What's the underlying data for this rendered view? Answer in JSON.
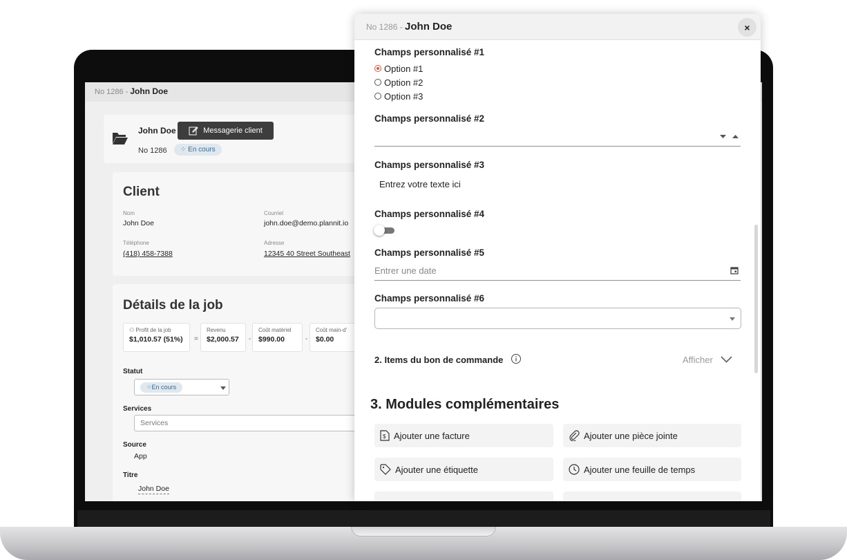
{
  "background_app": {
    "topbar": {
      "number": "No 1286 - ",
      "name": "John Doe"
    },
    "job_card": {
      "name": "John Doe",
      "message_button": "Messagerie client",
      "job_number": "No 1286",
      "status_chip": "En cours"
    },
    "client": {
      "title": "Client",
      "name_label": "Nom",
      "name": "John Doe",
      "email_label": "Courriel",
      "email": "john.doe@demo.plannit.io",
      "phone_label": "Téléphone",
      "phone": "(418) 458-7388",
      "address_label": "Adresse",
      "address": "12345 40 Street Southeast"
    },
    "job_details": {
      "title": "Détails de la job",
      "kpis": [
        {
          "label": "Profit de la job",
          "value": "$1,010.57 (51%)"
        },
        {
          "label": "Revenu",
          "value": "$2,000.57"
        },
        {
          "label": "Coût matériel",
          "value": "$990.00"
        },
        {
          "label": "Coût main-d'",
          "value": "$0.00"
        }
      ],
      "operators": [
        "=",
        "-",
        "-"
      ],
      "status_label": "Statut",
      "status_value": "En cours",
      "services_label": "Services",
      "services_placeholder": "Services",
      "source_label": "Source",
      "source_value": "App",
      "title_label": "Titre",
      "title_value": "John Doe"
    }
  },
  "modal": {
    "header": {
      "number": "No 1286 - ",
      "name": "John Doe",
      "close": "×"
    },
    "custom_fields": {
      "f1": {
        "label": "Champs personnalisé #1",
        "options": [
          "Option #1",
          "Option #2",
          "Option #3"
        ],
        "selected": "Option #1"
      },
      "f2": {
        "label": "Champs personnalisé #2"
      },
      "f3": {
        "label": "Champs personnalisé #3",
        "value": "Entrez votre texte ici"
      },
      "f4": {
        "label": "Champs personnalisé #4"
      },
      "f5": {
        "label": "Champs personnalisé #5",
        "placeholder": "Entrer une date"
      },
      "f6": {
        "label": "Champs personnalisé #6"
      }
    },
    "order_items": {
      "title": "2. Items du bon de commande",
      "toggle": "Afficher"
    },
    "modules": {
      "title": "3. Modules complémentaires",
      "buttons": [
        {
          "label": "Ajouter une facture",
          "icon": "invoice-icon"
        },
        {
          "label": "Ajouter une pièce jointe",
          "icon": "paperclip-icon"
        },
        {
          "label": "Ajouter une étiquette",
          "icon": "tag-icon"
        },
        {
          "label": "Ajouter une feuille de temps",
          "icon": "clock-icon"
        }
      ]
    }
  },
  "colors": {
    "accent": "#e0573b",
    "chip_bg": "#dfe7ef",
    "chip_text": "#3b6a8d",
    "dark_button": "#3d3d3d"
  }
}
